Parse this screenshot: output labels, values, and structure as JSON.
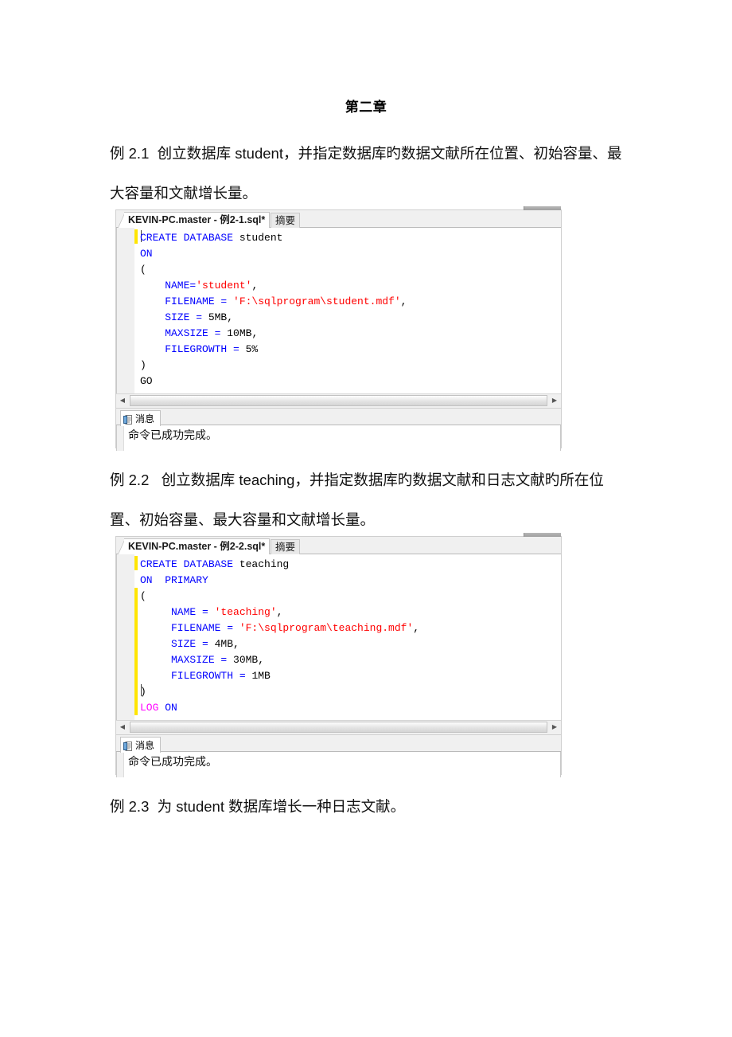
{
  "document": {
    "title": "第二章",
    "paragraphs": [
      {
        "id": "example-2-1",
        "text": "例 2.1  创立数据库 student，并指定数据库旳数据文献所在位置、初始容量、最大容量和文献增长量。"
      },
      {
        "id": "example-2-2",
        "text": "例 2.2   创立数据库 teaching，并指定数据库旳数据文献和日志文献旳所在位置、初始容量、最大容量和文献增长量。"
      },
      {
        "id": "example-2-3",
        "text": "例 2.3  为 student 数据库增长一种日志文献。"
      }
    ]
  },
  "screenshot_1": {
    "tab_active_label": "KEVIN-PC.master - 例2-1.sql*",
    "tab_inactive_label": "摘要",
    "code_lines": [
      [
        {
          "t": "CREATE DATABASE ",
          "c": "kw"
        },
        {
          "t": "student",
          "c": "pl"
        }
      ],
      [
        {
          "t": "ON",
          "c": "kw"
        }
      ],
      [
        {
          "t": "(",
          "c": "pl"
        }
      ],
      [
        {
          "t": "    NAME=",
          "c": "kw"
        },
        {
          "t": "'student'",
          "c": "str"
        },
        {
          "t": ",",
          "c": "pl"
        }
      ],
      [
        {
          "t": "    FILENAME = ",
          "c": "kw"
        },
        {
          "t": "'F:\\sqlprogram\\student.mdf'",
          "c": "str"
        },
        {
          "t": ",",
          "c": "pl"
        }
      ],
      [
        {
          "t": "    SIZE = ",
          "c": "kw"
        },
        {
          "t": "5MB",
          "c": "pl"
        },
        {
          "t": ",",
          "c": "pl"
        }
      ],
      [
        {
          "t": "    MAXSIZE = ",
          "c": "kw"
        },
        {
          "t": "10MB",
          "c": "pl"
        },
        {
          "t": ",",
          "c": "pl"
        }
      ],
      [
        {
          "t": "    FILEGROWTH = ",
          "c": "kw"
        },
        {
          "t": "5%",
          "c": "pl"
        }
      ],
      [
        {
          "t": ")",
          "c": "pl"
        }
      ],
      [
        {
          "t": "GO",
          "c": "pl"
        }
      ]
    ],
    "scrollbar": {
      "left_arrow": "◀",
      "right_arrow": "▶"
    },
    "results_tab_label": "消息",
    "results_message": "命令已成功完成。"
  },
  "screenshot_2": {
    "tab_active_label": "KEVIN-PC.master - 例2-2.sql*",
    "tab_inactive_label": "摘要",
    "code_lines": [
      [
        {
          "t": "CREATE DATABASE ",
          "c": "kw"
        },
        {
          "t": "teaching",
          "c": "pl"
        }
      ],
      [
        {
          "t": "ON  PRIMARY",
          "c": "kw"
        }
      ],
      [
        {
          "t": "(",
          "c": "pl"
        }
      ],
      [
        {
          "t": "     NAME = ",
          "c": "kw"
        },
        {
          "t": "'teaching'",
          "c": "str"
        },
        {
          "t": ",",
          "c": "pl"
        }
      ],
      [
        {
          "t": "     FILENAME = ",
          "c": "kw"
        },
        {
          "t": "'F:\\sqlprogram\\teaching.mdf'",
          "c": "str"
        },
        {
          "t": ",",
          "c": "pl"
        }
      ],
      [
        {
          "t": "     SIZE = ",
          "c": "kw"
        },
        {
          "t": "4MB",
          "c": "pl"
        },
        {
          "t": ",",
          "c": "pl"
        }
      ],
      [
        {
          "t": "     MAXSIZE = ",
          "c": "kw"
        },
        {
          "t": "30MB",
          "c": "pl"
        },
        {
          "t": ",",
          "c": "pl"
        }
      ],
      [
        {
          "t": "     FILEGROWTH = ",
          "c": "kw"
        },
        {
          "t": "1MB",
          "c": "pl"
        }
      ],
      [
        {
          "t": ")",
          "c": "pl"
        }
      ],
      [
        {
          "t": "LOG ",
          "c": "magenta"
        },
        {
          "t": "ON",
          "c": "kw"
        }
      ]
    ],
    "scrollbar": {
      "left_arrow": "◀",
      "right_arrow": "▶"
    },
    "results_tab_label": "消息",
    "results_message": "命令已成功完成。"
  },
  "colors": {
    "keyword": "#0000ff",
    "string": "#ff0000",
    "plain": "#000000",
    "magenta": "#ff00ff",
    "change_bar": "#ffe500",
    "chrome": "#f0f0f0"
  }
}
